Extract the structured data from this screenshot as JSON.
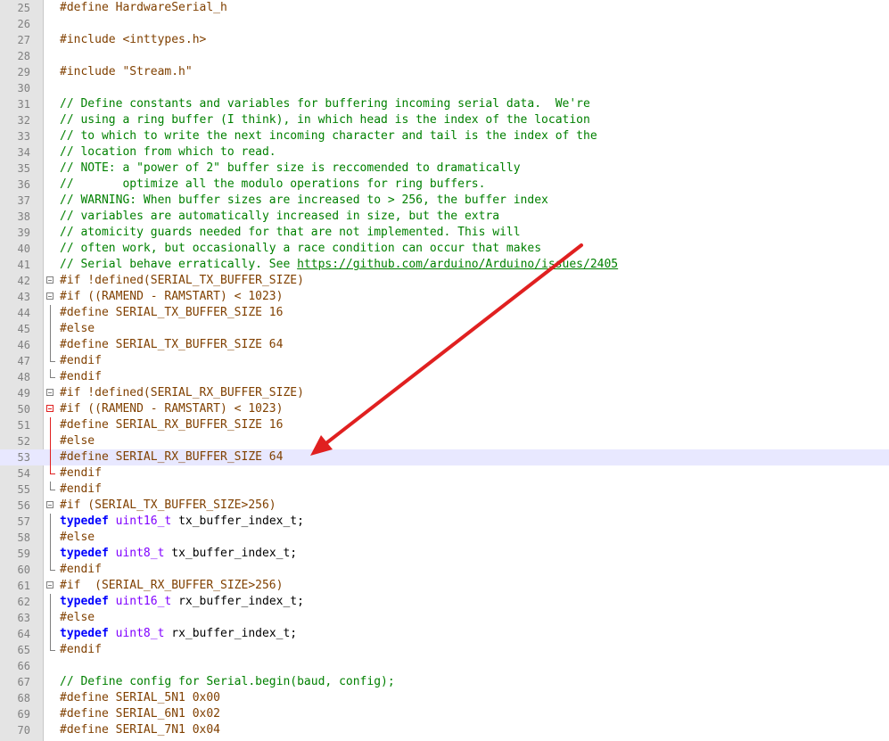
{
  "editor": {
    "current_line": 53,
    "lines": [
      {
        "n": "25",
        "fold": "",
        "parts": [
          {
            "c": "pp",
            "t": "#define HardwareSerial_h"
          }
        ]
      },
      {
        "n": "26",
        "fold": "",
        "parts": []
      },
      {
        "n": "27",
        "fold": "",
        "parts": [
          {
            "c": "pp",
            "t": "#include <inttypes.h>"
          }
        ]
      },
      {
        "n": "28",
        "fold": "",
        "parts": []
      },
      {
        "n": "29",
        "fold": "",
        "parts": [
          {
            "c": "pp",
            "t": "#include \"Stream.h\""
          }
        ]
      },
      {
        "n": "30",
        "fold": "",
        "parts": []
      },
      {
        "n": "31",
        "fold": "",
        "parts": [
          {
            "c": "cm",
            "t": "// Define constants and variables for buffering incoming serial data.  We're"
          }
        ]
      },
      {
        "n": "32",
        "fold": "",
        "parts": [
          {
            "c": "cm",
            "t": "// using a ring buffer (I think), in which head is the index of the location"
          }
        ]
      },
      {
        "n": "33",
        "fold": "",
        "parts": [
          {
            "c": "cm",
            "t": "// to which to write the next incoming character and tail is the index of the"
          }
        ]
      },
      {
        "n": "34",
        "fold": "",
        "parts": [
          {
            "c": "cm",
            "t": "// location from which to read."
          }
        ]
      },
      {
        "n": "35",
        "fold": "",
        "parts": [
          {
            "c": "cm",
            "t": "// NOTE: a \"power of 2\" buffer size is reccomended to dramatically"
          }
        ]
      },
      {
        "n": "36",
        "fold": "",
        "parts": [
          {
            "c": "cm",
            "t": "//       optimize all the modulo operations for ring buffers."
          }
        ]
      },
      {
        "n": "37",
        "fold": "",
        "parts": [
          {
            "c": "cm",
            "t": "// WARNING: When buffer sizes are increased to > 256, the buffer index"
          }
        ]
      },
      {
        "n": "38",
        "fold": "",
        "parts": [
          {
            "c": "cm",
            "t": "// variables are automatically increased in size, but the extra"
          }
        ]
      },
      {
        "n": "39",
        "fold": "",
        "parts": [
          {
            "c": "cm",
            "t": "// atomicity guards needed for that are not implemented. This will"
          }
        ]
      },
      {
        "n": "40",
        "fold": "",
        "parts": [
          {
            "c": "cm",
            "t": "// often work, but occasionally a race condition can occur that makes"
          }
        ]
      },
      {
        "n": "41",
        "fold": "",
        "parts": [
          {
            "c": "cm",
            "t": "// Serial behave erratically. See "
          },
          {
            "c": "lnk",
            "t": "https://github.com/arduino/Arduino/issues/2405"
          }
        ]
      },
      {
        "n": "42",
        "fold": "box",
        "parts": [
          {
            "c": "pp",
            "t": "#if !defined(SERIAL_TX_BUFFER_SIZE)"
          }
        ]
      },
      {
        "n": "43",
        "fold": "box",
        "parts": [
          {
            "c": "pp",
            "t": "#if ((RAMEND - RAMSTART) < 1023)"
          }
        ]
      },
      {
        "n": "44",
        "fold": "line-v",
        "parts": [
          {
            "c": "pp",
            "t": "#define SERIAL_TX_BUFFER_SIZE 16"
          }
        ]
      },
      {
        "n": "45",
        "fold": "line-v",
        "parts": [
          {
            "c": "pp",
            "t": "#else"
          }
        ]
      },
      {
        "n": "46",
        "fold": "line-v",
        "parts": [
          {
            "c": "pp",
            "t": "#define SERIAL_TX_BUFFER_SIZE 64"
          }
        ]
      },
      {
        "n": "47",
        "fold": "end",
        "parts": [
          {
            "c": "pp",
            "t": "#endif"
          }
        ]
      },
      {
        "n": "48",
        "fold": "end",
        "parts": [
          {
            "c": "pp",
            "t": "#endif"
          }
        ]
      },
      {
        "n": "49",
        "fold": "box",
        "parts": [
          {
            "c": "pp",
            "t": "#if !defined(SERIAL_RX_BUFFER_SIZE)"
          }
        ]
      },
      {
        "n": "50",
        "fold": "box red",
        "parts": [
          {
            "c": "pp",
            "t": "#if ((RAMEND - RAMSTART) < 1023)"
          }
        ]
      },
      {
        "n": "51",
        "fold": "line-v red",
        "parts": [
          {
            "c": "pp",
            "t": "#define SERIAL_RX_BUFFER_SIZE 16"
          }
        ]
      },
      {
        "n": "52",
        "fold": "line-v red",
        "parts": [
          {
            "c": "pp",
            "t": "#else"
          }
        ]
      },
      {
        "n": "53",
        "fold": "line-v red",
        "parts": [
          {
            "c": "pp",
            "t": "#define SERIAL_RX_BUFFER_SIZE 64"
          }
        ]
      },
      {
        "n": "54",
        "fold": "end red",
        "parts": [
          {
            "c": "pp",
            "t": "#endif"
          }
        ]
      },
      {
        "n": "55",
        "fold": "end",
        "parts": [
          {
            "c": "pp",
            "t": "#endif"
          }
        ]
      },
      {
        "n": "56",
        "fold": "box",
        "parts": [
          {
            "c": "pp",
            "t": "#if (SERIAL_TX_BUFFER_SIZE>256)"
          }
        ]
      },
      {
        "n": "57",
        "fold": "line-v",
        "parts": [
          {
            "c": "kw",
            "t": "typedef"
          },
          {
            "c": "tx",
            "t": " "
          },
          {
            "c": "ty",
            "t": "uint16_t"
          },
          {
            "c": "tx",
            "t": " tx_buffer_index_t;"
          }
        ]
      },
      {
        "n": "58",
        "fold": "line-v",
        "parts": [
          {
            "c": "pp",
            "t": "#else"
          }
        ]
      },
      {
        "n": "59",
        "fold": "line-v",
        "parts": [
          {
            "c": "kw",
            "t": "typedef"
          },
          {
            "c": "tx",
            "t": " "
          },
          {
            "c": "ty",
            "t": "uint8_t"
          },
          {
            "c": "tx",
            "t": " tx_buffer_index_t;"
          }
        ]
      },
      {
        "n": "60",
        "fold": "end",
        "parts": [
          {
            "c": "pp",
            "t": "#endif"
          }
        ]
      },
      {
        "n": "61",
        "fold": "box",
        "parts": [
          {
            "c": "pp",
            "t": "#if  (SERIAL_RX_BUFFER_SIZE>256)"
          }
        ]
      },
      {
        "n": "62",
        "fold": "line-v",
        "parts": [
          {
            "c": "kw",
            "t": "typedef"
          },
          {
            "c": "tx",
            "t": " "
          },
          {
            "c": "ty",
            "t": "uint16_t"
          },
          {
            "c": "tx",
            "t": " rx_buffer_index_t;"
          }
        ]
      },
      {
        "n": "63",
        "fold": "line-v",
        "parts": [
          {
            "c": "pp",
            "t": "#else"
          }
        ]
      },
      {
        "n": "64",
        "fold": "line-v",
        "parts": [
          {
            "c": "kw",
            "t": "typedef"
          },
          {
            "c": "tx",
            "t": " "
          },
          {
            "c": "ty",
            "t": "uint8_t"
          },
          {
            "c": "tx",
            "t": " rx_buffer_index_t;"
          }
        ]
      },
      {
        "n": "65",
        "fold": "end",
        "parts": [
          {
            "c": "pp",
            "t": "#endif"
          }
        ]
      },
      {
        "n": "66",
        "fold": "",
        "parts": []
      },
      {
        "n": "67",
        "fold": "",
        "parts": [
          {
            "c": "cm",
            "t": "// Define config for Serial.begin(baud, config);"
          }
        ]
      },
      {
        "n": "68",
        "fold": "",
        "parts": [
          {
            "c": "pp",
            "t": "#define SERIAL_5N1 0x00"
          }
        ]
      },
      {
        "n": "69",
        "fold": "",
        "parts": [
          {
            "c": "pp",
            "t": "#define SERIAL_6N1 0x02"
          }
        ]
      },
      {
        "n": "70",
        "fold": "",
        "parts": [
          {
            "c": "pp",
            "t": "#define SERIAL_7N1 0x04"
          }
        ]
      }
    ]
  },
  "colors": {
    "comment": "#008000",
    "preprocessor": "#804000",
    "keyword": "#0000ff",
    "type": "#8000ff",
    "current_line_bg": "#e8e8ff",
    "annotation_arrow": "#e02020"
  }
}
